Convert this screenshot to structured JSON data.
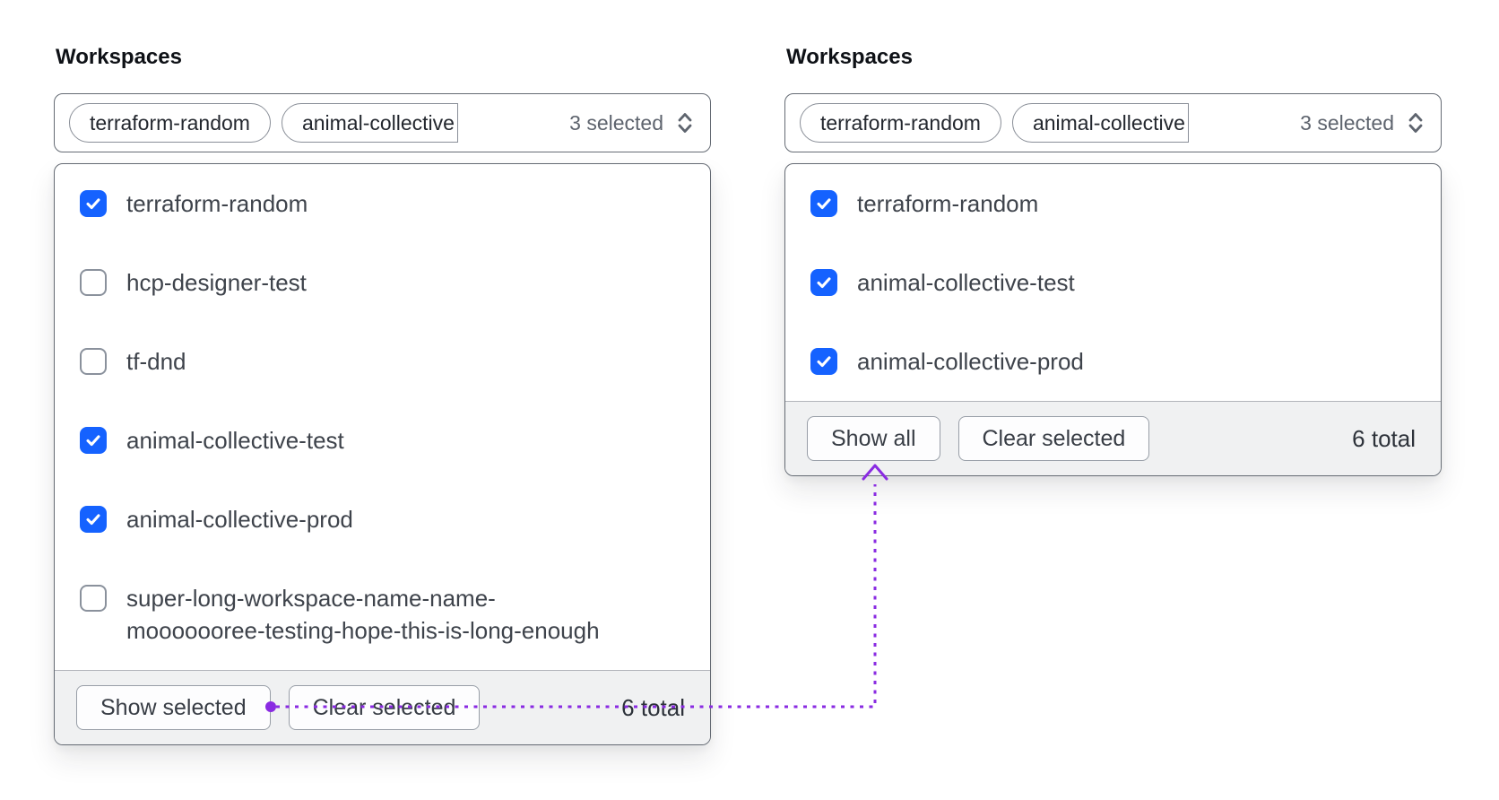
{
  "colors": {
    "checkbox_blue": "#1562ff",
    "annotation_purple": "#8a2be2",
    "footer_bg": "#f0f1f2"
  },
  "panels": [
    {
      "label": "Workspaces",
      "trigger": {
        "pills": [
          "terraform-random",
          "animal-collective"
        ],
        "summary": "3 selected"
      },
      "items": [
        {
          "label": "terraform-random",
          "checked": true
        },
        {
          "label": "hcp-designer-test",
          "checked": false
        },
        {
          "label": "tf-dnd",
          "checked": false
        },
        {
          "label": "animal-collective-test",
          "checked": true
        },
        {
          "label": "animal-collective-prod",
          "checked": true
        },
        {
          "label": "super-long-workspace-name-name-",
          "label2": "mooooooree-testing-hope-this-is-long-enough",
          "checked": false
        }
      ],
      "footer": {
        "buttons": [
          "Show selected",
          "Clear selected"
        ],
        "total": "6 total"
      }
    },
    {
      "label": "Workspaces",
      "trigger": {
        "pills": [
          "terraform-random",
          "animal-collective"
        ],
        "summary": "3 selected"
      },
      "items": [
        {
          "label": "terraform-random",
          "checked": true
        },
        {
          "label": "animal-collective-test",
          "checked": true
        },
        {
          "label": "animal-collective-prod",
          "checked": true
        }
      ],
      "footer": {
        "buttons": [
          "Show all",
          "Clear selected"
        ],
        "total": "6 total"
      }
    }
  ]
}
